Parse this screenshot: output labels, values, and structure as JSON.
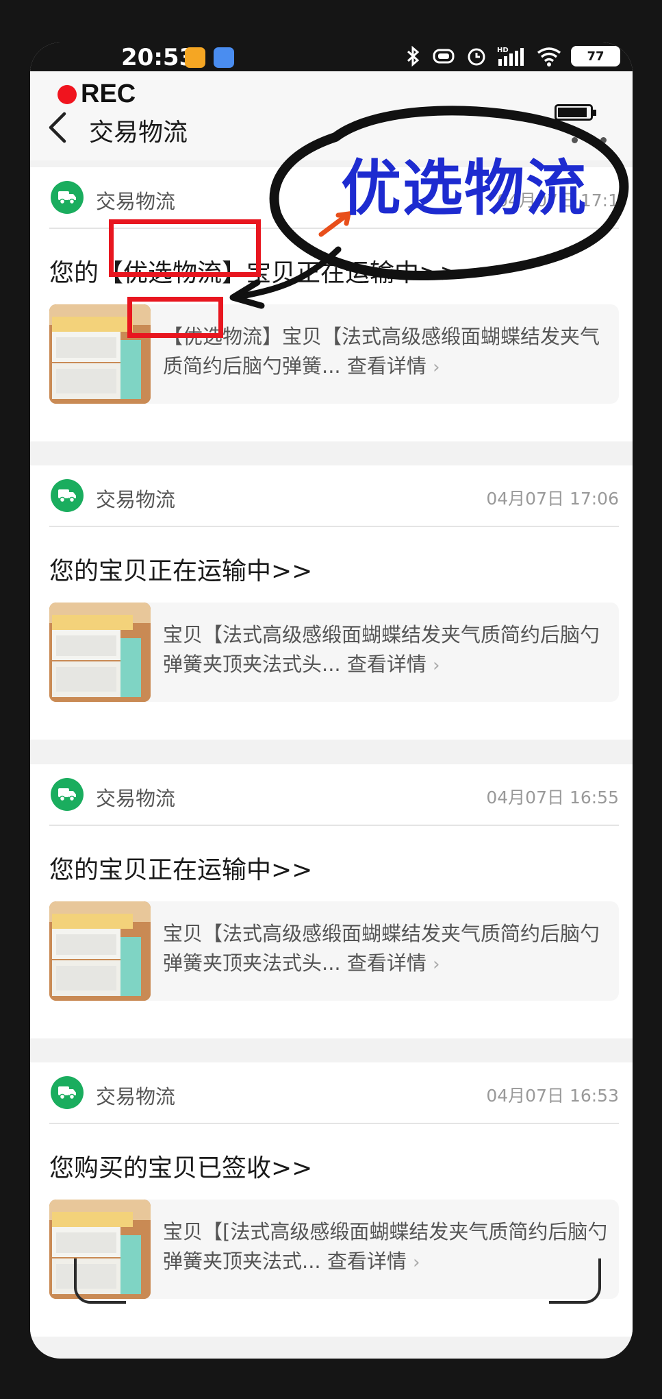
{
  "status_bar": {
    "time": "20:53",
    "battery": "77",
    "signal_label": "HD"
  },
  "recording": {
    "label": "REC"
  },
  "nav": {
    "title": "交易物流"
  },
  "overlay": {
    "title": "优选物流"
  },
  "cards": [
    {
      "source": "交易物流",
      "time": "04月07日 17:1",
      "title_prefix": "您的",
      "title_highlight": "【优选物流】",
      "title_suffix": "宝贝正在运输中>>",
      "desc_highlight": "【优选物流】",
      "desc": "宝贝【法式高级感缎面蝴蝶结发夹气质简约后脑勺弹簧...",
      "details": "查看详情"
    },
    {
      "source": "交易物流",
      "time": "04月07日 17:06",
      "title": "您的宝贝正在运输中>>",
      "desc": "宝贝【法式高级感缎面蝴蝶结发夹气质简约后脑勺弹簧夹顶夹法式头...",
      "details": "查看详情"
    },
    {
      "source": "交易物流",
      "time": "04月07日 16:55",
      "title": "您的宝贝正在运输中>>",
      "desc": "宝贝【法式高级感缎面蝴蝶结发夹气质简约后脑勺弹簧夹顶夹法式头...",
      "details": "查看详情"
    },
    {
      "source": "交易物流",
      "time": "04月07日 16:53",
      "title": "您购买的宝贝已签收>>",
      "desc": "宝贝【[法式高级感缎面蝴蝶结发夹气质简约后脑勺弹簧夹顶夹法式...",
      "details": "查看详情"
    }
  ],
  "colors": {
    "accent_green": "#1aad5e",
    "highlight_red": "#e8161f",
    "overlay_blue": "#1d2bd0"
  },
  "icons": [
    "back-arrow-icon",
    "more-icon",
    "truck-icon",
    "chevron-right-icon",
    "bluetooth-icon",
    "alarm-icon",
    "wifi-icon",
    "battery-icon"
  ]
}
